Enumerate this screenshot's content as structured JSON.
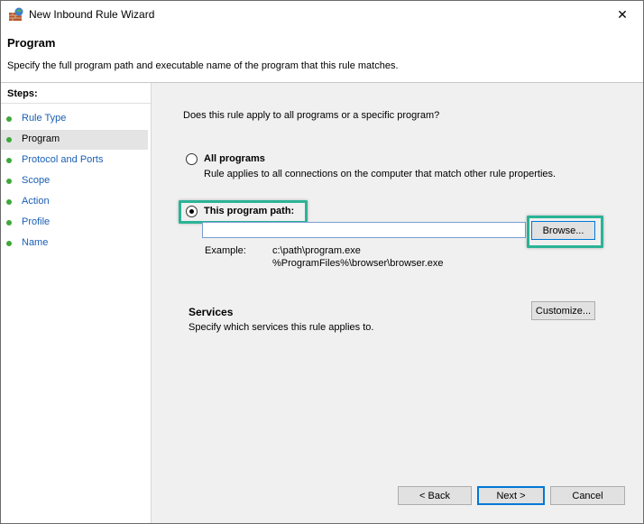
{
  "window": {
    "title": "New Inbound Rule Wizard",
    "close_glyph": "✕"
  },
  "header": {
    "title": "Program",
    "description": "Specify the full program path and executable name of the program that this rule matches."
  },
  "steps": {
    "title": "Steps:",
    "items": [
      {
        "label": "Rule Type",
        "active": false
      },
      {
        "label": "Program",
        "active": true
      },
      {
        "label": "Protocol and Ports",
        "active": false
      },
      {
        "label": "Scope",
        "active": false
      },
      {
        "label": "Action",
        "active": false
      },
      {
        "label": "Profile",
        "active": false
      },
      {
        "label": "Name",
        "active": false
      }
    ]
  },
  "main": {
    "question": "Does this rule apply to all programs or a specific program?",
    "all_programs": {
      "label": "All programs",
      "description": "Rule applies to all connections on the computer that match other rule properties.",
      "selected": false
    },
    "this_program": {
      "label": "This program path:",
      "selected": true,
      "value": "",
      "browse_label": "Browse..."
    },
    "example": {
      "label": "Example:",
      "line1": "c:\\path\\program.exe",
      "line2": "%ProgramFiles%\\browser\\browser.exe"
    },
    "services": {
      "title": "Services",
      "description": "Specify which services this rule applies to.",
      "customize_label": "Customize..."
    }
  },
  "footer": {
    "back_label": "< Back",
    "next_label": "Next >",
    "cancel_label": "Cancel"
  },
  "colors": {
    "highlight": "#2bb396",
    "step_link": "#1a5fb4",
    "step_bullet": "#3da83a",
    "accent": "#0078d7"
  },
  "icons": {
    "app": "firewall-icon",
    "close": "close-icon",
    "step": "step-bullet-icon"
  }
}
